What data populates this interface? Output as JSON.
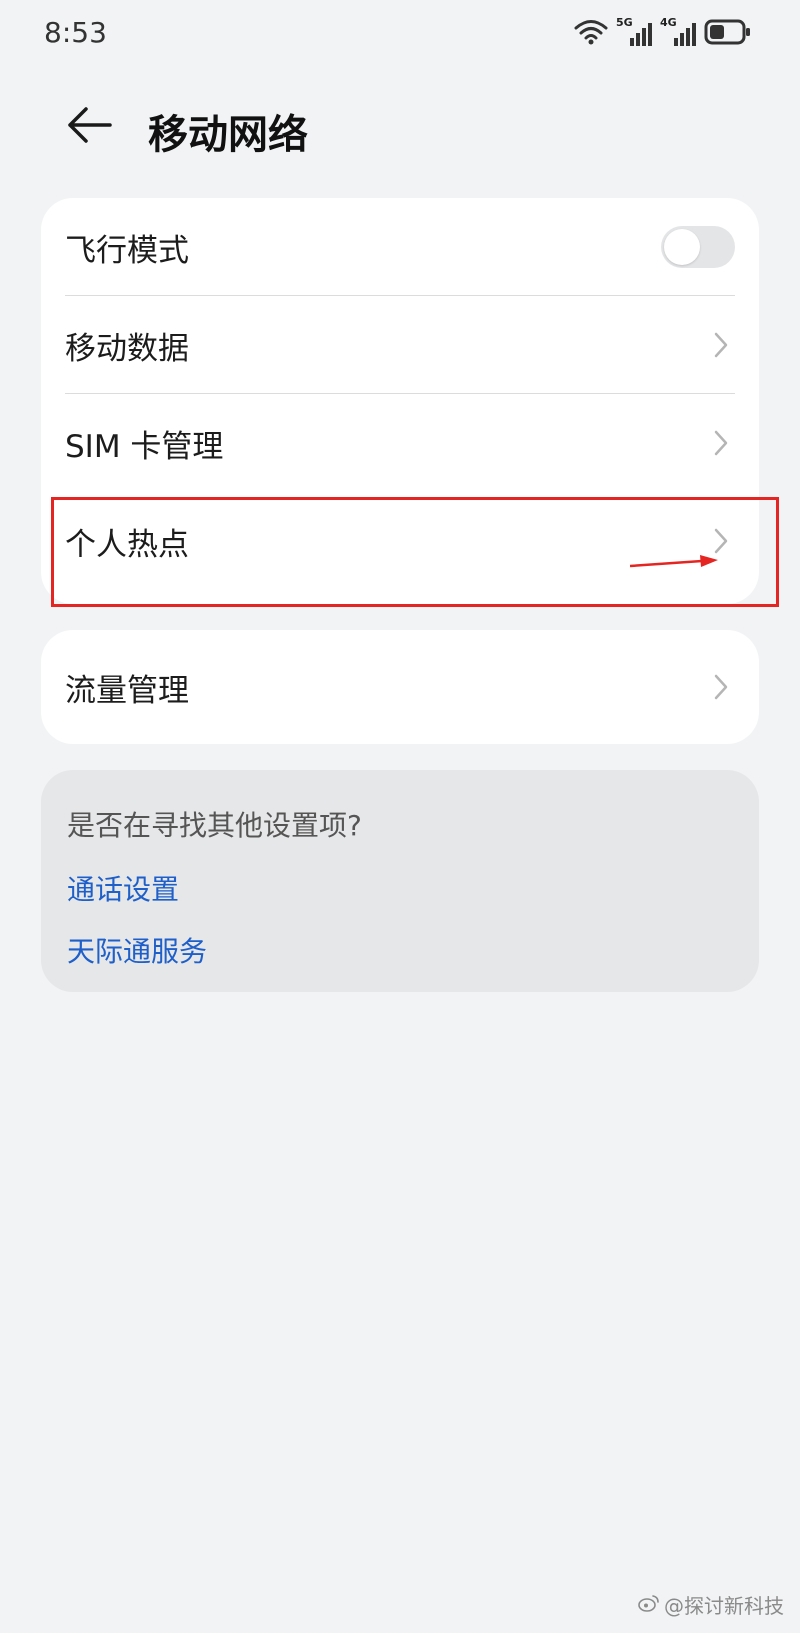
{
  "status_bar": {
    "time": "8:53",
    "network1": "5G",
    "network2": "4G",
    "icons": [
      "wifi-icon",
      "signal-5g-icon",
      "signal-4g-icon",
      "battery-icon"
    ]
  },
  "header": {
    "title": "移动网络",
    "back_icon": "back-arrow-icon"
  },
  "main_card": {
    "items": [
      {
        "label": "飞行模式",
        "control": "toggle",
        "toggle_on": false
      },
      {
        "label": "移动数据",
        "control": "chevron"
      },
      {
        "label": "SIM 卡管理",
        "control": "chevron"
      },
      {
        "label": "个人热点",
        "control": "chevron",
        "highlighted": true
      }
    ]
  },
  "second_card": {
    "items": [
      {
        "label": "流量管理",
        "control": "chevron"
      }
    ]
  },
  "hint": {
    "title": "是否在寻找其他设置项?",
    "links": [
      "通话设置",
      "天际通服务"
    ]
  },
  "watermark": {
    "text": "@探讨新科技",
    "icon": "weibo-logo-icon"
  },
  "colors": {
    "background": "#f1f3f5",
    "card": "#ffffff",
    "link": "#1e5fc9",
    "annotation": "#e52521"
  }
}
